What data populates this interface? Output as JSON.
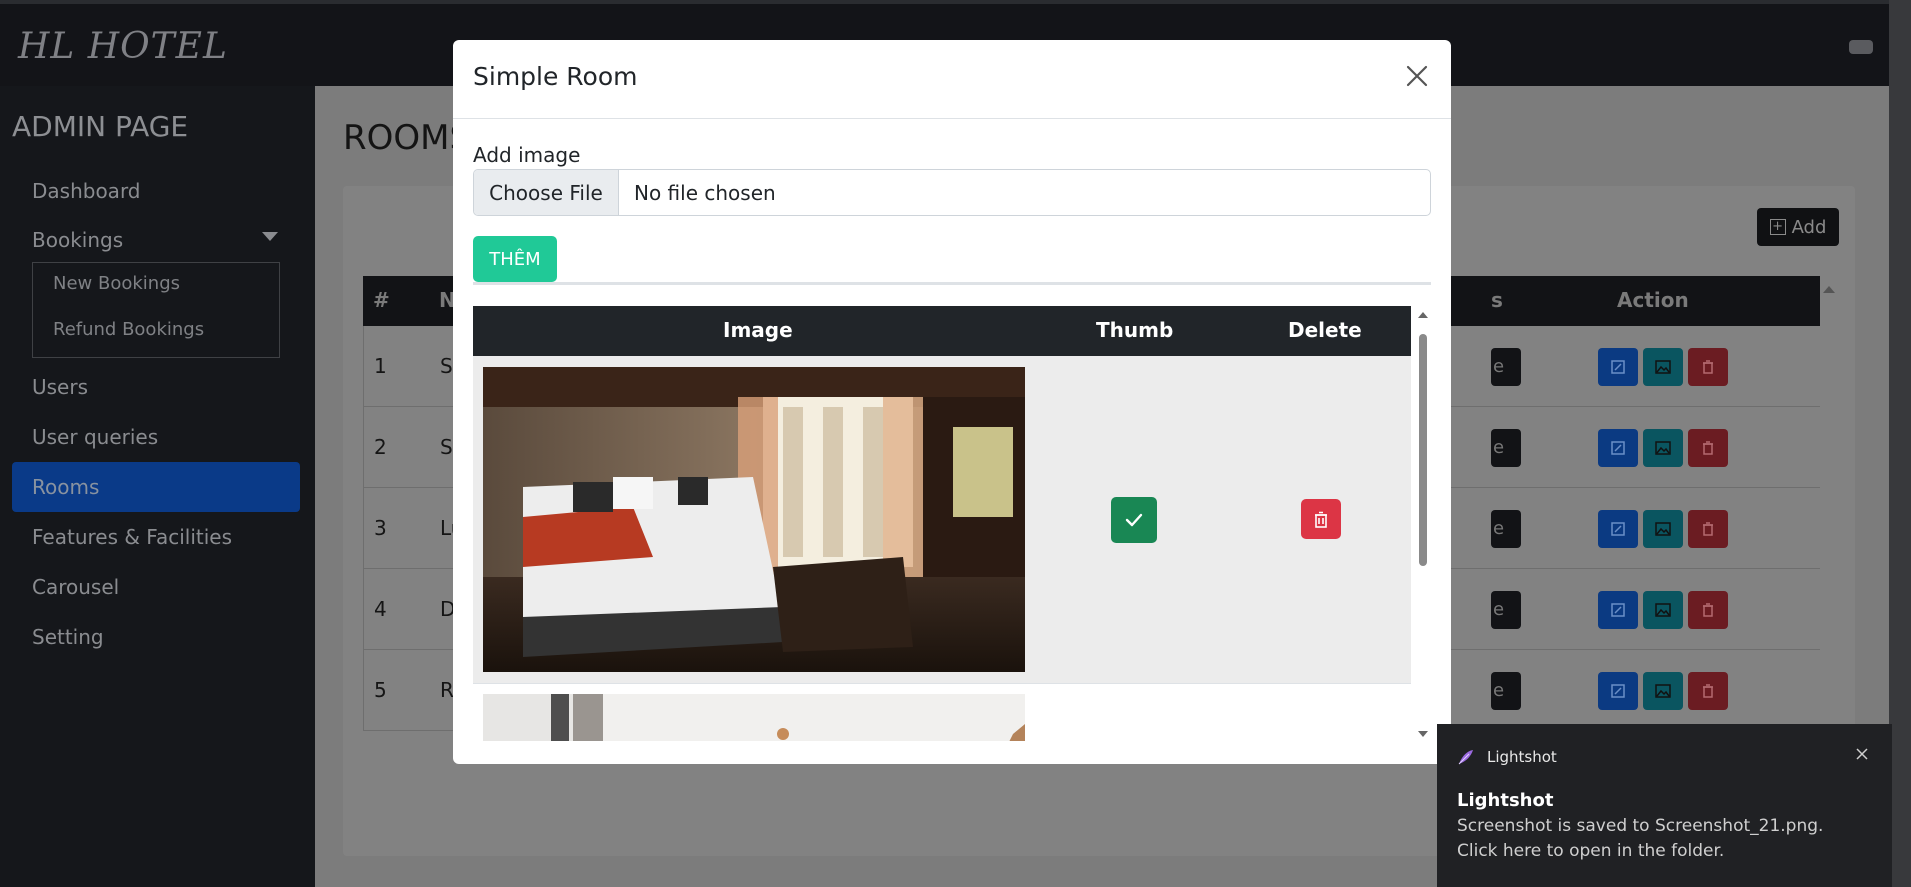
{
  "navbar": {
    "brand": "HL HOTEL"
  },
  "sidebar": {
    "title": "ADMIN PAGE",
    "items": [
      {
        "label": "Dashboard"
      },
      {
        "label": "Bookings"
      },
      {
        "label": "Users"
      },
      {
        "label": "User queries"
      },
      {
        "label": "Rooms"
      },
      {
        "label": "Features & Facilities"
      },
      {
        "label": "Carousel"
      },
      {
        "label": "Setting"
      }
    ],
    "sub_items": [
      {
        "label": "New Bookings"
      },
      {
        "label": "Refund Bookings"
      }
    ],
    "active": "Rooms"
  },
  "main": {
    "page_title": "ROOMS",
    "add_label": "Add",
    "table_headers": {
      "num": "#",
      "name": "N",
      "status": "s",
      "action": "Action"
    },
    "rows": [
      {
        "num": "1",
        "name": "S",
        "status": "e"
      },
      {
        "num": "2",
        "name": "S",
        "status": "e"
      },
      {
        "num": "3",
        "name": "Lu",
        "status": "e"
      },
      {
        "num": "4",
        "name": "D",
        "status": "e"
      },
      {
        "num": "5",
        "name": "R",
        "status": "e"
      }
    ]
  },
  "modal": {
    "title": "Simple Room",
    "add_image_label": "Add image",
    "file_button": "Choose File",
    "file_status": "No file chosen",
    "submit_label": "THÊM",
    "table_headers": {
      "image": "Image",
      "thumb": "Thumb",
      "delete": "Delete"
    }
  },
  "toast": {
    "app_name": "Lightshot",
    "title": "Lightshot",
    "message": "Screenshot is saved to Screenshot_21.png. Click here to open in the folder."
  },
  "colors": {
    "primary": "#0d6efd",
    "success": "#198754",
    "danger": "#dc3545",
    "info": "#0dcaf0",
    "teal": "#20c997",
    "dark": "#212529"
  }
}
